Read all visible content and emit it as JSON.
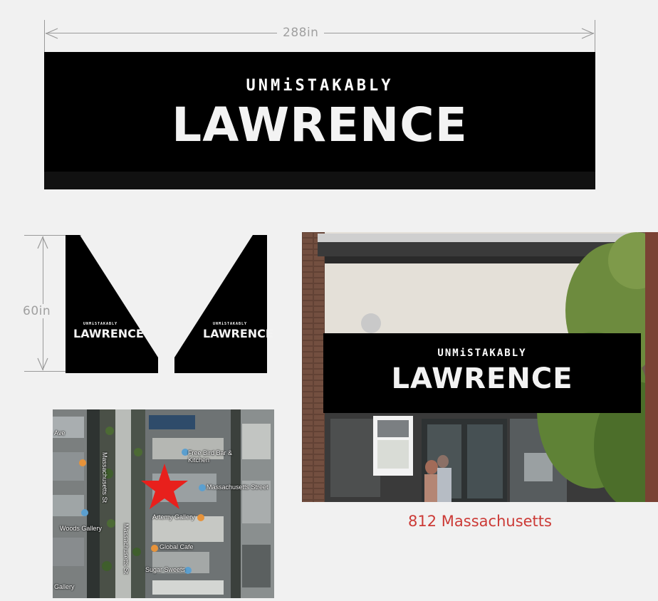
{
  "banner": {
    "width_label": "288in",
    "logo_top": "UNMiSTAKABLY",
    "logo_main": "LAWRENCE"
  },
  "side_panels": {
    "height_label": "60in",
    "logo_top": "UNMiSTAKABLY",
    "logo_main": "LAWRENCE"
  },
  "storefront": {
    "logo_top": "UNMiSTAKABLY",
    "logo_main": "LAWRENCE"
  },
  "map": {
    "labels": {
      "street_north": "Massachusetts St",
      "street_south": "Massachusetts St",
      "bar": "Free Bird Bar & Kitchen",
      "address_street": "Massachusetts Street",
      "gallery": "Artemy Gallery",
      "cafe": "Global Cafe",
      "sweets": "Sugar Sweets",
      "woods_gallery": "Woods Gallery",
      "ave": "Ave",
      "gallery_sw": "Gallery"
    },
    "marker_color": "#e8201c"
  },
  "address": "812 Massachusetts",
  "colors": {
    "background": "#f1f1f1",
    "banner": "#000000",
    "address_text": "#cc3a36"
  }
}
